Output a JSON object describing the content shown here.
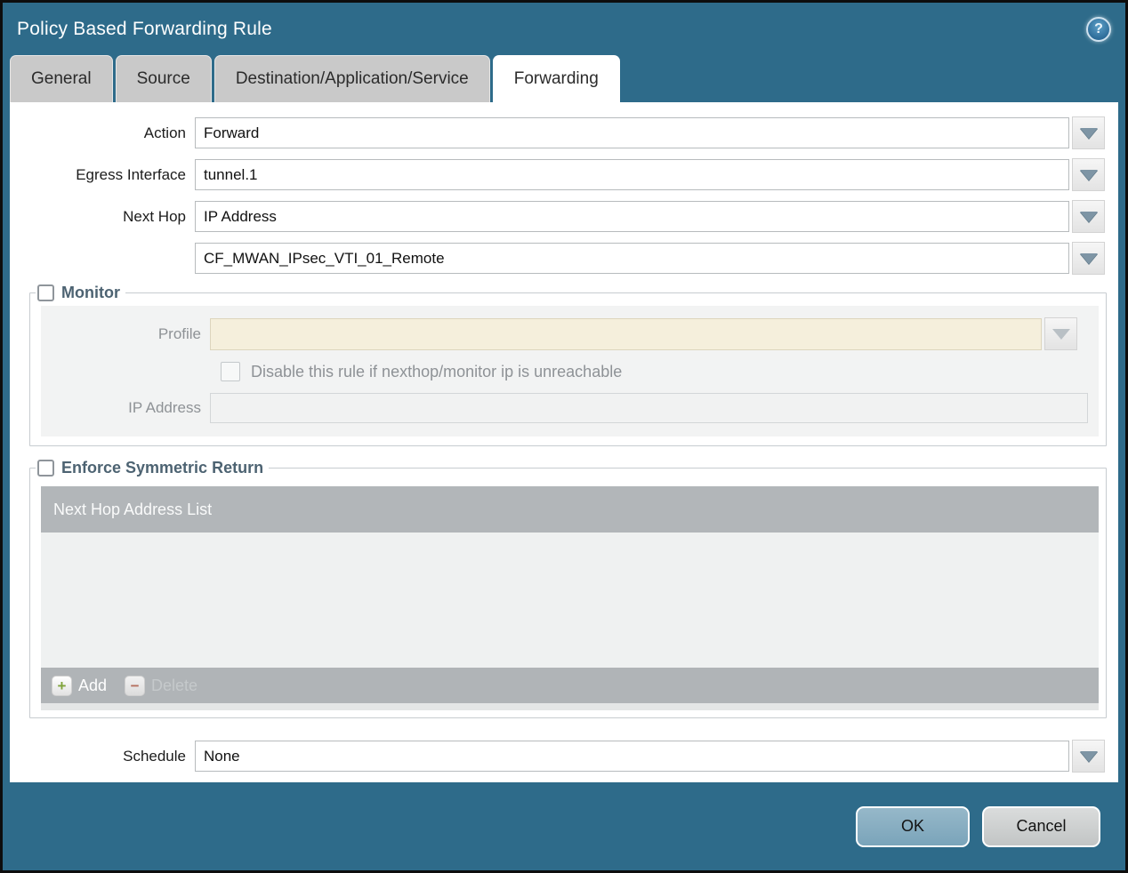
{
  "window": {
    "title": "Policy Based Forwarding Rule",
    "help_glyph": "?"
  },
  "tabs": [
    {
      "label": "General",
      "active": false
    },
    {
      "label": "Source",
      "active": false
    },
    {
      "label": "Destination/Application/Service",
      "active": false
    },
    {
      "label": "Forwarding",
      "active": true
    }
  ],
  "form": {
    "action": {
      "label": "Action",
      "value": "Forward"
    },
    "egress_interface": {
      "label": "Egress Interface",
      "value": "tunnel.1"
    },
    "next_hop": {
      "label": "Next Hop",
      "value": "IP Address"
    },
    "next_hop_address": {
      "value": "CF_MWAN_IPsec_VTI_01_Remote"
    },
    "schedule": {
      "label": "Schedule",
      "value": "None"
    }
  },
  "monitor": {
    "legend": "Monitor",
    "checked": false,
    "profile_label": "Profile",
    "profile_value": "",
    "disable_rule_label": "Disable this rule if nexthop/monitor ip is unreachable",
    "disable_rule_checked": false,
    "ip_address_label": "IP Address",
    "ip_address_value": ""
  },
  "symmetric_return": {
    "legend": "Enforce Symmetric Return",
    "checked": false,
    "table_header": "Next Hop Address List",
    "rows": [],
    "add_label": "Add",
    "delete_label": "Delete",
    "add_icon_glyph": "+",
    "delete_icon_glyph": "−"
  },
  "footer": {
    "ok_label": "OK",
    "cancel_label": "Cancel"
  },
  "colors": {
    "titlebar_bg": "#2e6b8a",
    "inactive_tab_bg": "#c9c9c9",
    "legend_text": "#4d6372",
    "table_header_bg": "#b2b6b9",
    "profile_field_bg": "#f5efdc",
    "ok_button_bg": "#7aa4ba",
    "caret_color": "#7e95a5"
  }
}
